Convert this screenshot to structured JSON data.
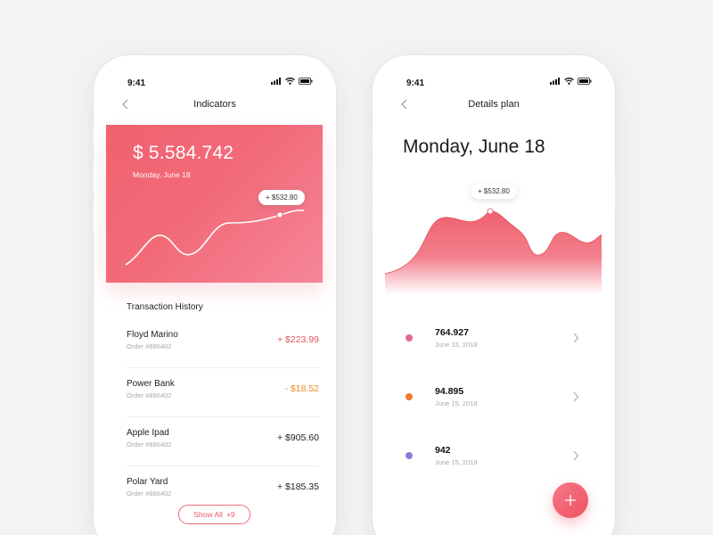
{
  "statusbar": {
    "time": "9:41"
  },
  "left": {
    "title": "Indicators",
    "hero": {
      "amount": "$ 5.584.742",
      "date": "Monday, June 18",
      "tooltip": "+ $532.80"
    },
    "section_title": "Transaction History",
    "transactions": [
      {
        "name": "Floyd Marino",
        "order": "Order #886402",
        "amount": "+ $223.99",
        "color": "#e0545f"
      },
      {
        "name": "Power Bank",
        "order": "Order #886402",
        "amount": "- $18.52",
        "color": "#f08a2c"
      },
      {
        "name": "Apple Ipad",
        "order": "Order #886402",
        "amount": "+ $905.60",
        "color": "#222222"
      },
      {
        "name": "Polar Yard",
        "order": "Order #886402",
        "amount": "+ $185.35",
        "color": "#222222"
      }
    ],
    "show_all": {
      "label": "Show All",
      "count": "+9"
    }
  },
  "right": {
    "title": "Details plan",
    "date": "Monday, June 18",
    "tooltip": "+ $532.80",
    "plans": [
      {
        "value": "764.927",
        "date": "June 15, 2018",
        "color": "#e06a95"
      },
      {
        "value": "94.895",
        "date": "June 15, 2018",
        "color": "#f07a2a"
      },
      {
        "value": "942",
        "date": "June 15, 2018",
        "color": "#9577d8"
      }
    ]
  },
  "colors": {
    "accent": "#f06270",
    "accent_light": "#f58698",
    "background": "#f3f3f4"
  },
  "icons": {
    "back": "chevron-left-icon",
    "next": "chevron-right-icon",
    "signal": "signal-icon",
    "wifi": "wifi-icon",
    "battery": "battery-icon",
    "add": "plus-icon"
  }
}
